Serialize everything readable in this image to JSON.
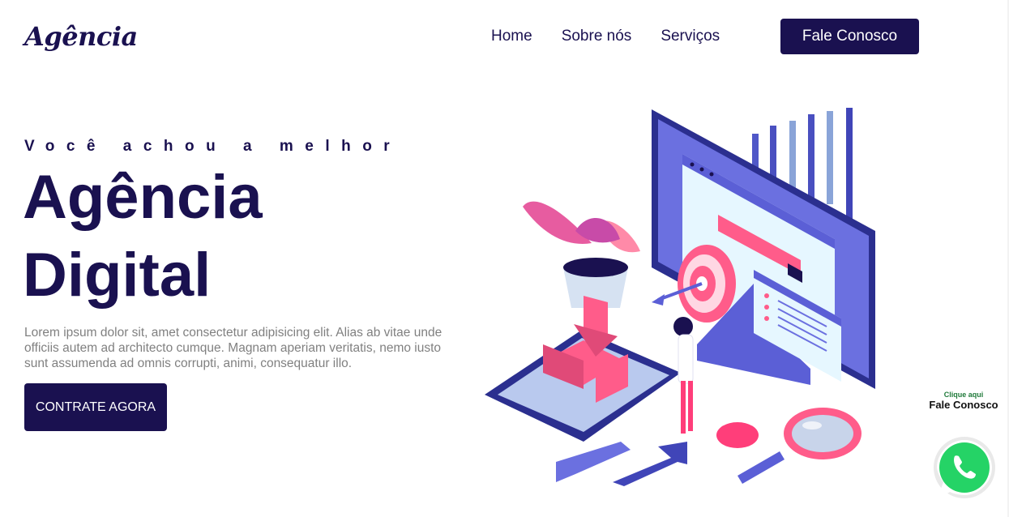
{
  "header": {
    "logo": "Agência",
    "nav": [
      {
        "label": "Home"
      },
      {
        "label": "Sobre nós"
      },
      {
        "label": "Serviços"
      }
    ],
    "cta_label": "Fale Conosco"
  },
  "hero": {
    "eyebrow": "Você achou a melhor",
    "title_line1": "Agência",
    "title_line2": "Digital",
    "description": "Lorem ipsum dolor sit, amet consectetur adipisicing elit. Alias ab vitae unde officiis autem ad architecto cumque. Magnam aperiam veritatis, nemo iusto sunt assumenda ad omnis corrupti, animi, consequatur illo.",
    "cta_label": "CONTRATE AGORA",
    "illustration_icon": "digital-marketing-illustration"
  },
  "whatsapp": {
    "small_label": "Clique aqui",
    "big_label": "Fale Conosco",
    "icon": "whatsapp-icon"
  },
  "colors": {
    "primary": "#1a1150",
    "accent_pink": "#ff5c8a",
    "accent_purple": "#5b5fd6",
    "whatsapp_green": "#25d366"
  }
}
